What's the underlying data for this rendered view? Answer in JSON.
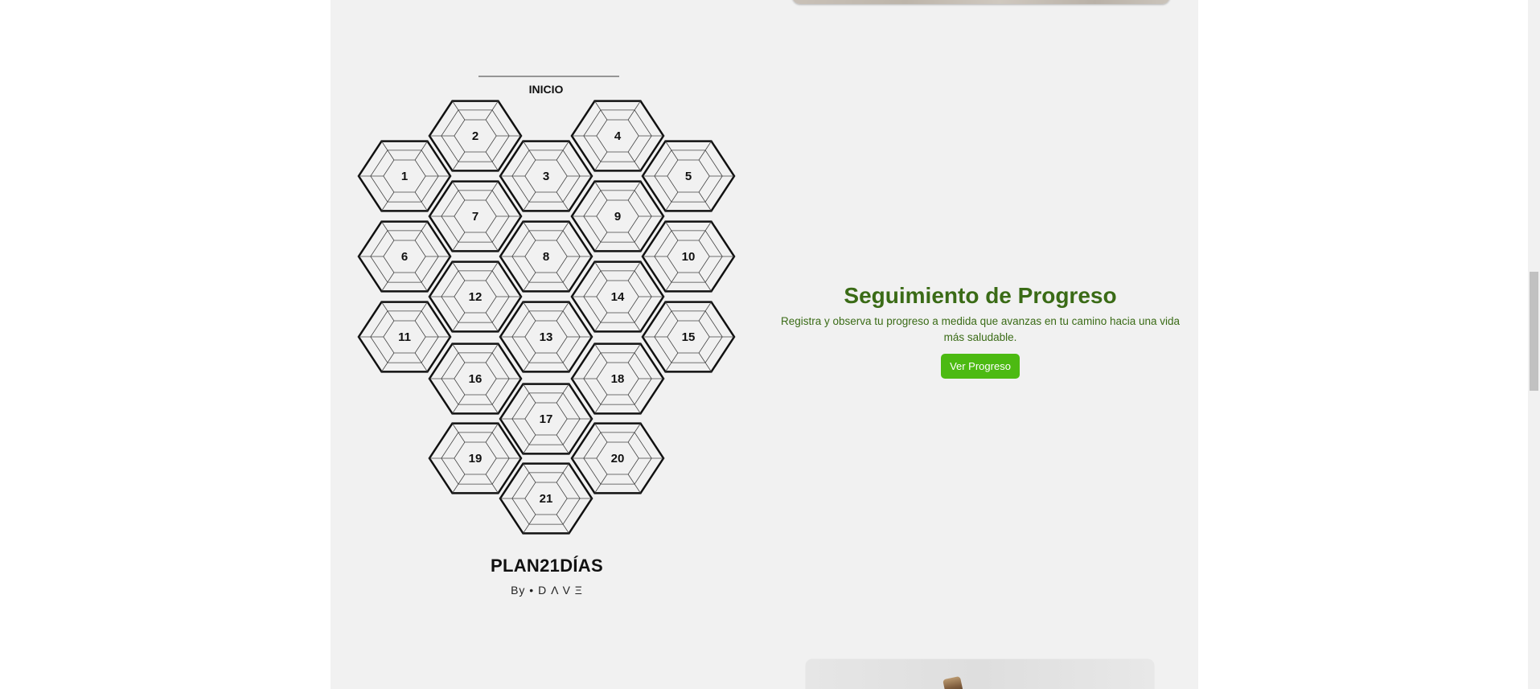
{
  "plan_graphic": {
    "start_label": "INICIO",
    "hexagons": [
      {
        "number": "1",
        "col": 0,
        "row": 1.0
      },
      {
        "number": "2",
        "col": 1,
        "row": 0.0
      },
      {
        "number": "3",
        "col": 2,
        "row": 1.0
      },
      {
        "number": "4",
        "col": 3,
        "row": 0.0
      },
      {
        "number": "5",
        "col": 4,
        "row": 1.0
      },
      {
        "number": "6",
        "col": 0,
        "row": 2.0
      },
      {
        "number": "7",
        "col": 1,
        "row": 2.0
      },
      {
        "number": "8",
        "col": 2,
        "row": 2.0
      },
      {
        "number": "9",
        "col": 3,
        "row": 2.0
      },
      {
        "number": "10",
        "col": 4,
        "row": 2.0
      },
      {
        "number": "11",
        "col": 0,
        "row": 3.0
      },
      {
        "number": "12",
        "col": 1,
        "row": 3.0
      },
      {
        "number": "13",
        "col": 2,
        "row": 3.0
      },
      {
        "number": "14",
        "col": 3,
        "row": 3.0
      },
      {
        "number": "15",
        "col": 4,
        "row": 3.0
      },
      {
        "number": "16",
        "col": 1,
        "row": 4.0
      },
      {
        "number": "17",
        "col": 2,
        "row": 4.0
      },
      {
        "number": "18",
        "col": 3,
        "row": 4.0
      },
      {
        "number": "19",
        "col": 1,
        "row": 5.0
      },
      {
        "number": "20",
        "col": 3,
        "row": 5.0
      },
      {
        "number": "21",
        "col": 2,
        "row": 5.0
      }
    ],
    "brand_title": "PLAN21DÍAS",
    "brand_by": "By • D Λ V Ξ"
  },
  "progress_section": {
    "title": "Seguimiento de Progreso",
    "description": "Registra y observa tu progreso a medida que avanzas en tu camino hacia una vida más saludable.",
    "button_label": "Ver Progreso"
  },
  "colors": {
    "accent_text": "#3a6b16",
    "button_bg": "#4cba12",
    "section_bg": "#f1f1f1"
  }
}
